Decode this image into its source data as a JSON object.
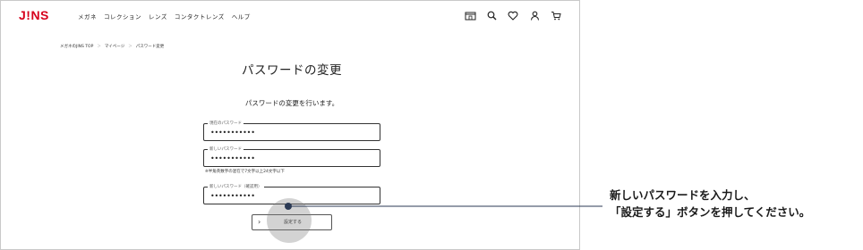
{
  "header": {
    "logo": "J!NS",
    "nav": [
      "メガネ",
      "コレクション",
      "レンズ",
      "コンタクトレンズ",
      "ヘルプ"
    ],
    "icons": [
      "store-icon",
      "search-icon",
      "heart-icon",
      "user-icon",
      "cart-icon"
    ]
  },
  "breadcrumb": [
    "メガネのJINS TOP",
    "マイページ",
    "パスワード変更"
  ],
  "breadcrumb_separator": "＞",
  "page": {
    "title": "パスワードの変更",
    "subtitle": "パスワードの変更を行います。"
  },
  "form": {
    "current_password": {
      "label": "現在のパスワード",
      "value": "•••••••••••"
    },
    "new_password": {
      "label": "新しいパスワード",
      "value": "•••••••••••"
    },
    "note": "※半角英数字の混在で7文字以上24文字以下",
    "confirm_password": {
      "label": "新しいパスワード（確認用）",
      "value": "•••••••••••"
    },
    "submit": {
      "arrow": "›",
      "label": "設定する"
    }
  },
  "annotation": {
    "line1": "新しいパスワードを入力し、",
    "line2": "「設定する」ボタンを押してください。"
  },
  "colors": {
    "brand": "#d6001c",
    "annotation_line": "#2b3a55"
  }
}
